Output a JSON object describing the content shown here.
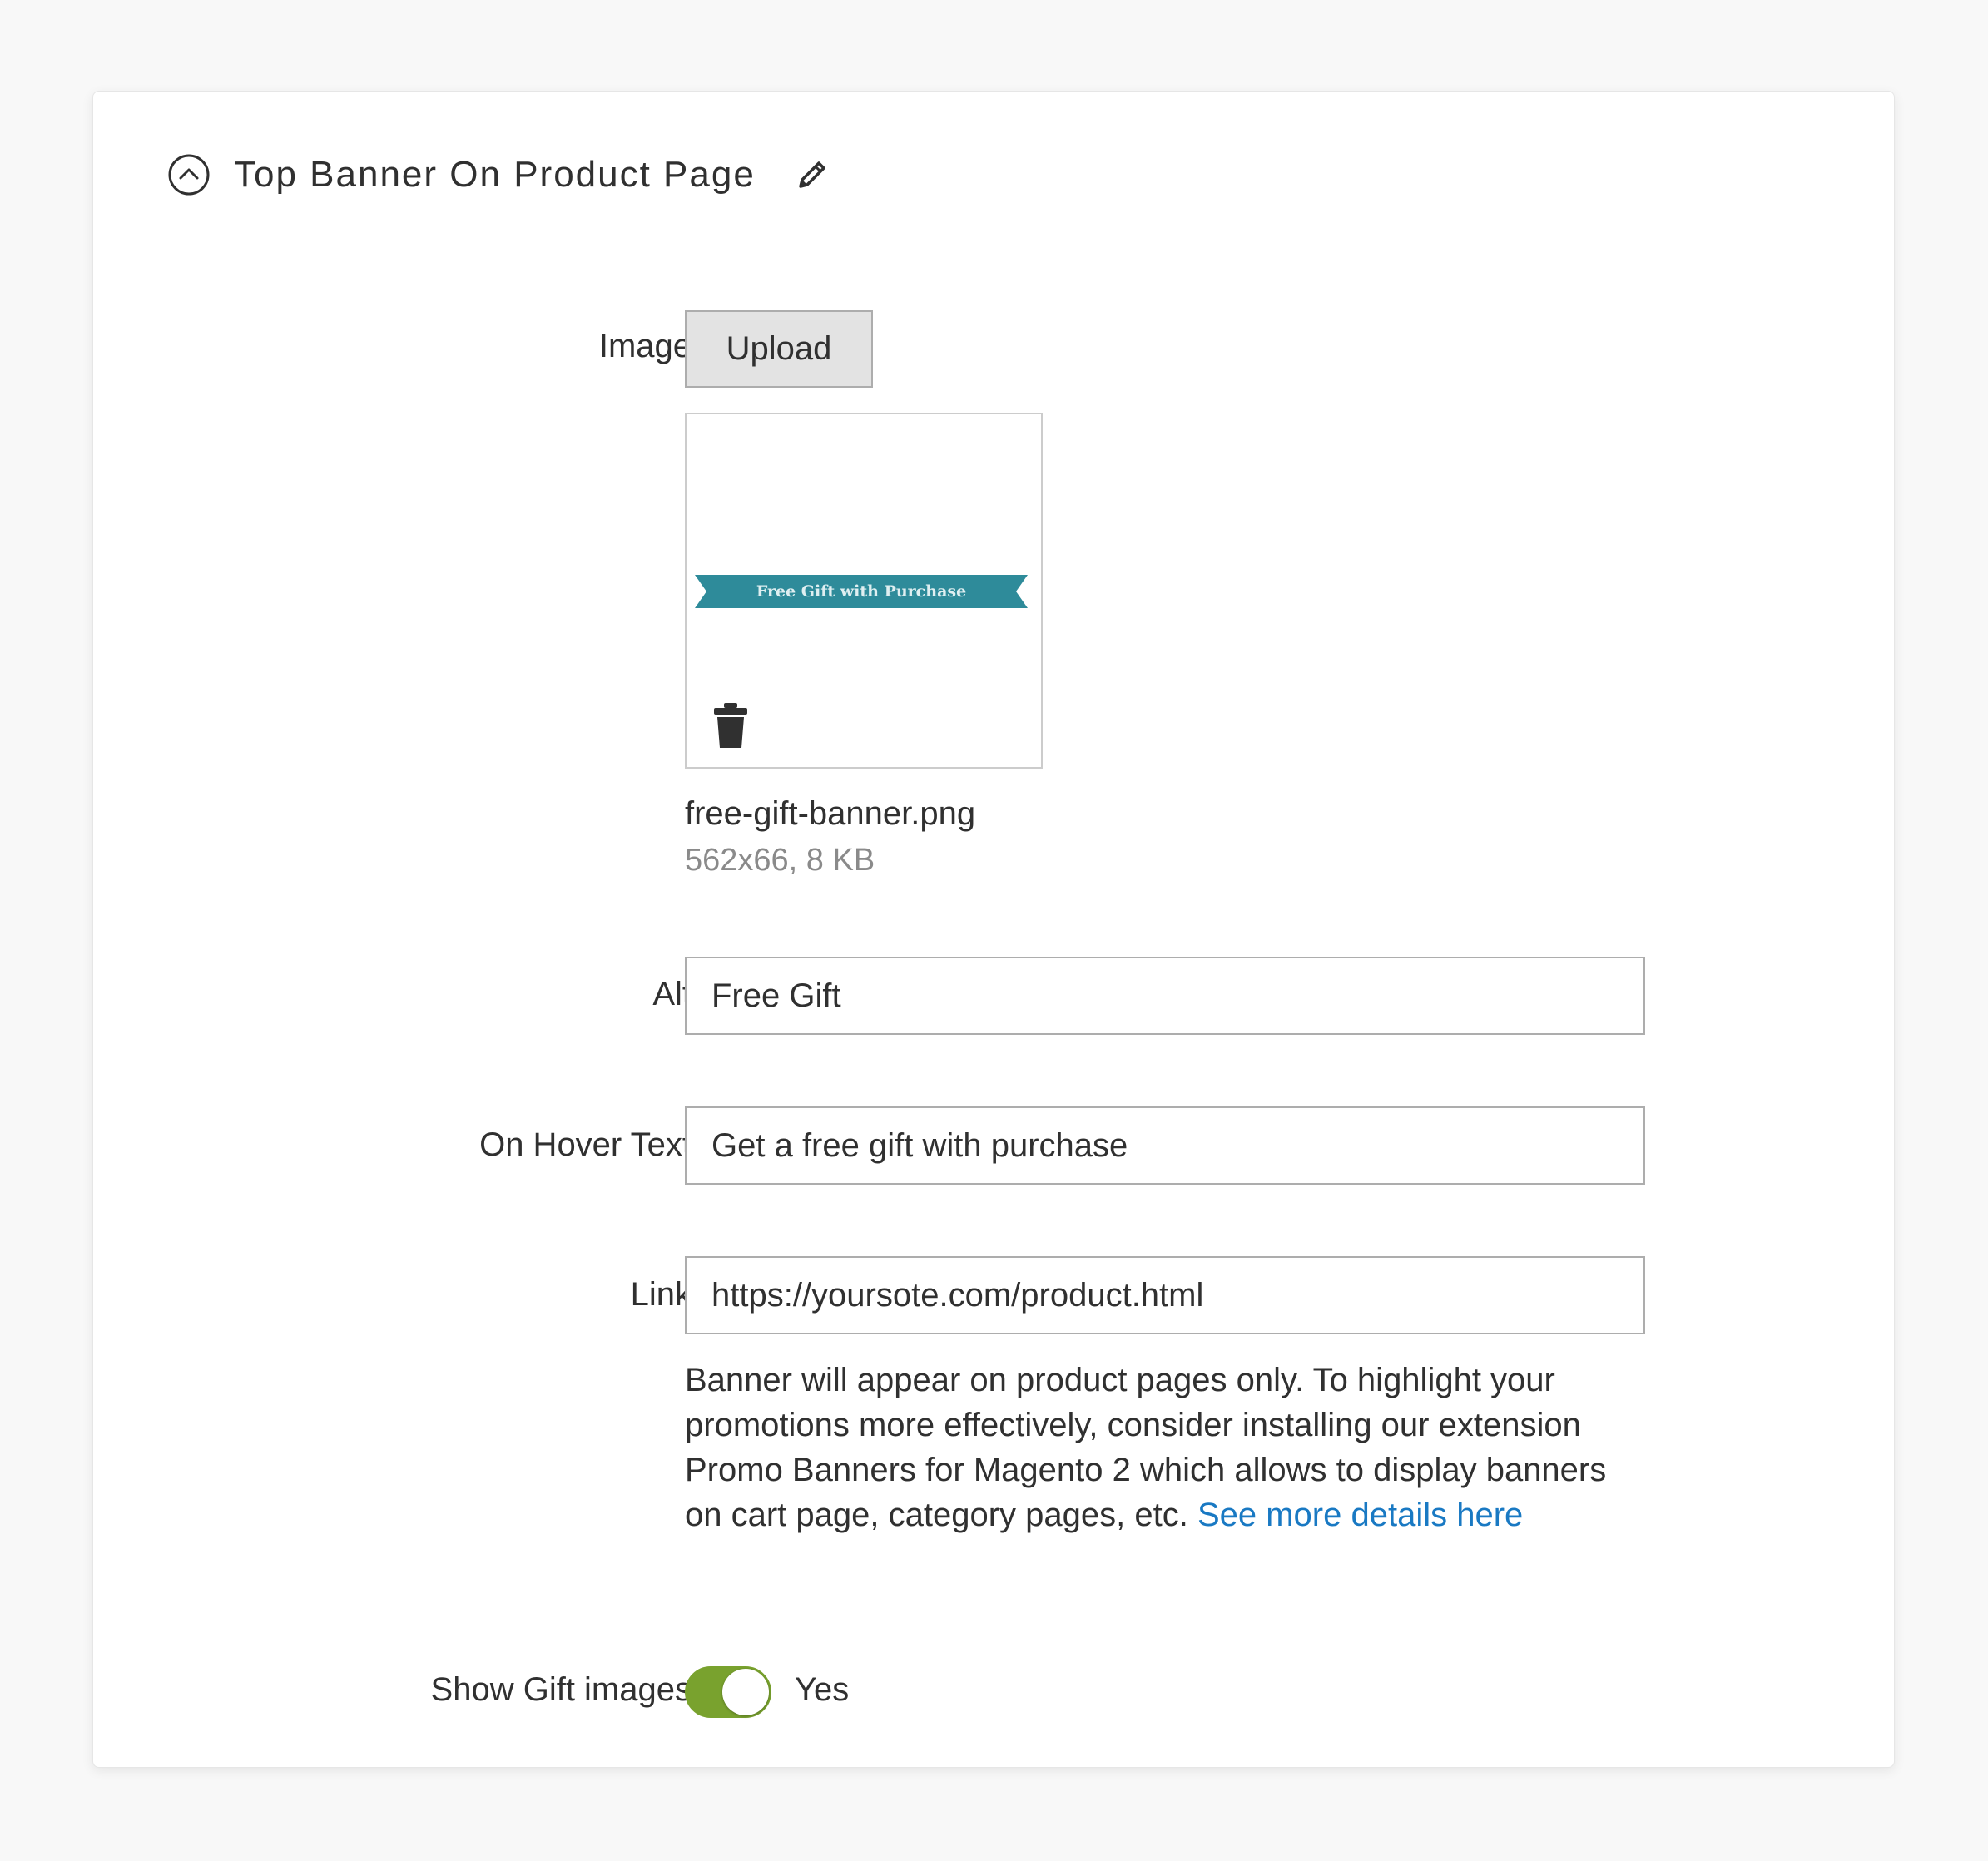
{
  "section": {
    "title": "Top Banner On Product Page",
    "collapse_icon": "chevron-up-circle-icon",
    "edit_icon": "pencil-icon"
  },
  "image_field": {
    "label": "Image",
    "upload_label": "Upload",
    "preview": {
      "banner_text": "Free Gift with Purchase",
      "banner_color": "#2e8b9a",
      "delete_icon": "trash-icon"
    },
    "file_name": "free-gift-banner.png",
    "file_meta": "562x66, 8 KB"
  },
  "alt_field": {
    "label": "Alt",
    "value": "Free Gift"
  },
  "hover_field": {
    "label": "On Hover Text",
    "value": "Get a free gift with purchase"
  },
  "link_field": {
    "label": "Link",
    "value": "https://yoursote.com/product.html",
    "note_text": "Banner will appear on product pages only. To highlight your promotions more effectively, consider installing our extension Promo Banners for Magento 2 which allows to display banners on cart page, category pages, etc. ",
    "note_link": "See more details here"
  },
  "gift_images_field": {
    "label": "Show Gift images",
    "toggle_state": "on",
    "toggle_label": "Yes",
    "toggle_color": "#79a22e"
  }
}
